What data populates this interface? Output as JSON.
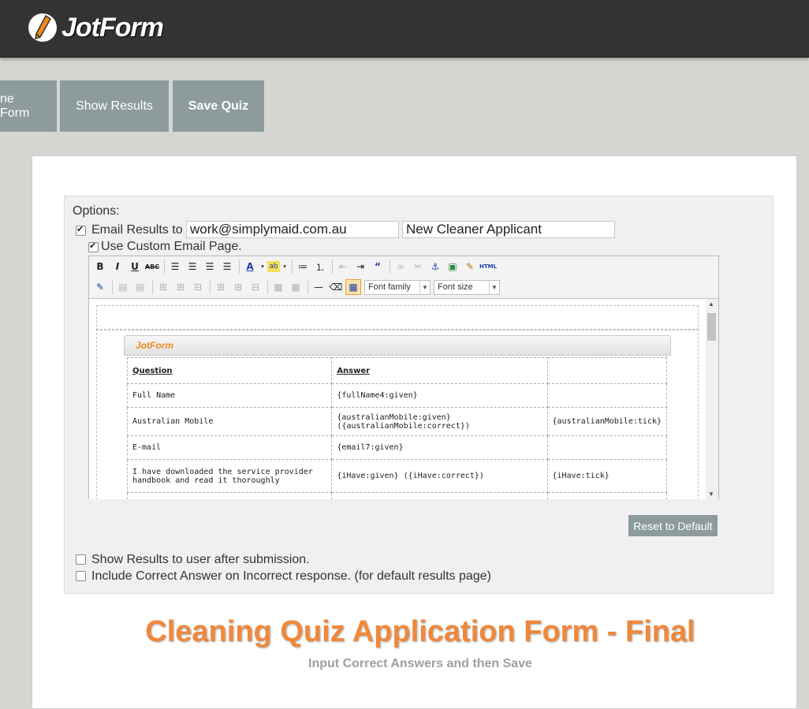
{
  "header": {
    "logo_text": "JotForm"
  },
  "tabs": [
    {
      "label": "ne Form"
    },
    {
      "label": "Show Results"
    },
    {
      "label": "Save Quiz"
    }
  ],
  "options": {
    "heading": "Options:",
    "email_results": {
      "label": "Email Results to",
      "checked": true,
      "email_value": "work@simplymaid.com.au",
      "subject_value": "New Cleaner Applicant"
    },
    "custom_email": {
      "label": "Use Custom Email Page.",
      "checked": true
    },
    "show_results": {
      "label": "Show Results to user after submission.",
      "checked": false
    },
    "include_correct": {
      "label": "Include Correct Answer on Incorrect response. (for default results page)",
      "checked": false
    },
    "reset_label": "Reset to Default"
  },
  "editor": {
    "toolbar": {
      "row1": [
        "B",
        "I",
        "U",
        "ABC",
        "align-left",
        "align-center",
        "align-right",
        "align-justify",
        "font-color",
        "highlight",
        "bullet-list",
        "numbered-list",
        "outdent",
        "indent",
        "blockquote",
        "link",
        "unlink",
        "anchor",
        "image",
        "cleanup",
        "HTML"
      ],
      "font_family": "Font family",
      "font_size": "Font size"
    },
    "email_logo": "JotForm",
    "table": {
      "headers": [
        "Question",
        "Answer",
        ""
      ],
      "rows": [
        [
          "Full Name",
          "{fullName4:given}",
          ""
        ],
        [
          "Australian Mobile",
          "{australianMobile:given}\n({australianMobile:correct})",
          "{australianMobile:tick}"
        ],
        [
          "E-mail",
          "{email7:given}",
          ""
        ],
        [
          "I have downloaded the service provider\nhandbook and read it thoroughly",
          "{iHave:given} ({iHave:correct})",
          "{iHave:tick}"
        ]
      ]
    }
  },
  "page": {
    "title": "Cleaning Quiz Application Form - Final",
    "subtitle": "Input Correct Answers and then Save"
  },
  "colors": {
    "accent": "#f0883b",
    "tab_bg": "#8d9b9c",
    "topbar": "#333333",
    "background": "#d5d6d1"
  }
}
